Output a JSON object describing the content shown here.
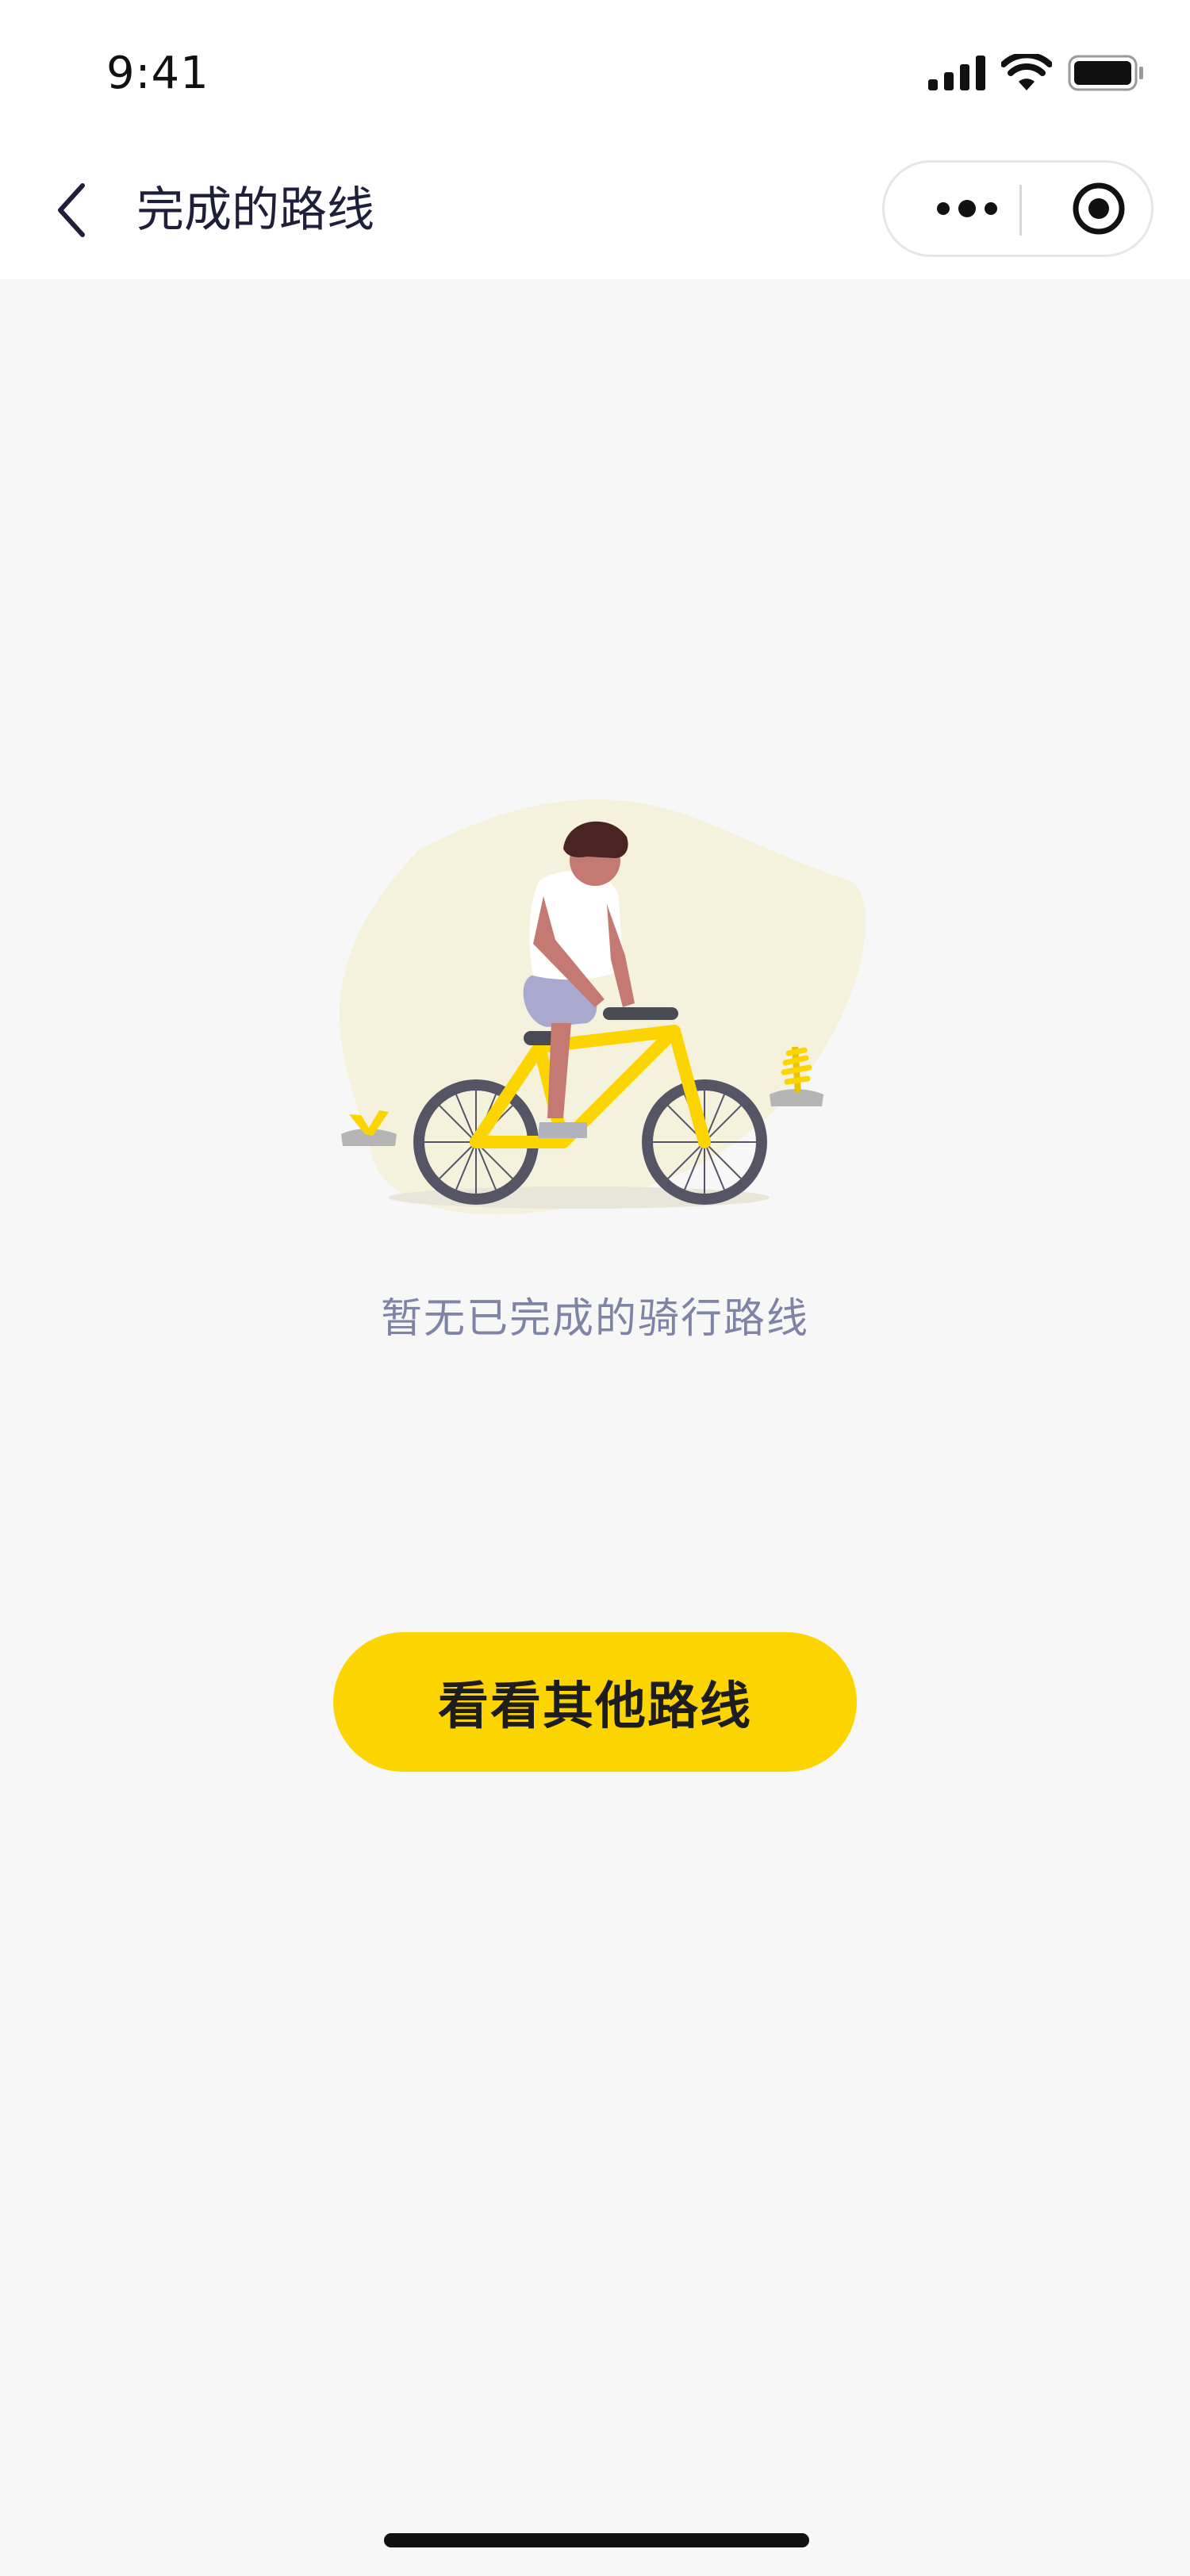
{
  "status_bar": {
    "time": "9:41"
  },
  "nav": {
    "title": "完成的路线"
  },
  "empty_state": {
    "message": "暂无已完成的骑行路线",
    "illustration": "person-riding-bicycle"
  },
  "cta": {
    "label": "看看其他路线"
  },
  "colors": {
    "accent": "#FCD500",
    "background": "#F7F7F7",
    "title_text": "#1F1F3A",
    "muted_text": "#7F83A5"
  }
}
